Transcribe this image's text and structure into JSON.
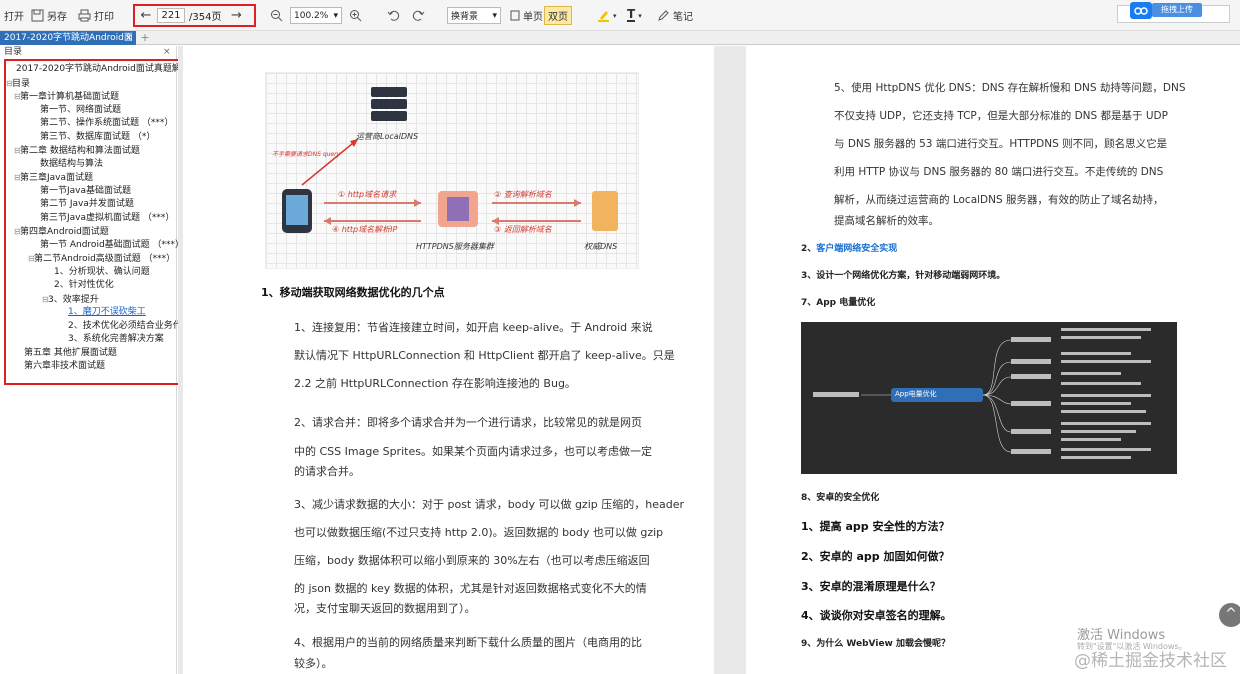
{
  "toolbar": {
    "open_label": "打开",
    "save_label": "另存",
    "print_label": "打印",
    "current_page": "221",
    "total_pages": "/354页",
    "zoom": "100.2%",
    "background_label": "换背景",
    "single_page_label": "单页",
    "double_page_label": "双页",
    "notes_label": "笔记",
    "upload_label": "拖拽上传"
  },
  "tabs": {
    "doc_tab_title": "2017-2020字节跳动Android面",
    "close_glyph": "×",
    "add_glyph": "+"
  },
  "sidebar": {
    "header": "目录",
    "close_glyph": "×",
    "toc": [
      "2017-2020字节跳动Android面试真题解析",
      "目录",
      "第一章计算机基础面试题",
      "第一节、网络面试题",
      "第二节、操作系统面试题 （***）",
      "第三节、数据库面试题 （*）",
      "第二章 数据结构和算法面试题",
      "数据结构与算法",
      "第三章Java面试题",
      "第一节Java基础面试题",
      "第二节 Java并发面试题",
      "第三节Java虚拟机面试题 （***）",
      "第四章Android面试题",
      "第一节 Android基础面试题 （***）",
      "第二节Android高级面试题 （***）",
      "1、分析现状、确认问题",
      "2、针对性优化",
      "3、效率提升",
      "1、磨刀不误砍柴工",
      "2、技术优化必须结合业务代码",
      "3、系统化完善解决方案",
      "第五章 其他扩展面试题",
      "第六章非技术面试题"
    ]
  },
  "page_left": {
    "figure_labels": {
      "operator_dns": "运营商LocalDNS",
      "red_note": "不手需要请求DNS query",
      "http_request": "① http域名请求",
      "query_domain": "② 查询解析域名",
      "return_ip": "④ http域名解析IP",
      "return_domain": "③ 返回解析域名",
      "httpdns_cluster": "HTTPDNS服务器集群",
      "authority_dns": "权威DNS"
    },
    "heading": "1、移动端获取网络数据优化的几个点",
    "paragraphs": [
      "1、连接复用：节省连接建立时间，如开启 keep-alive。于 Android 来说",
      "默认情况下 HttpURLConnection 和 HttpClient 都开启了 keep-alive。只是",
      "2.2 之前 HttpURLConnection 存在影响连接池的 Bug。",
      "2、请求合并：即将多个请求合并为一个进行请求，比较常见的就是网页",
      "中的 CSS Image Sprites。如果某个页面内请求过多，也可以考虑做一定",
      "的请求合并。",
      "3、减少请求数据的大小：对于 post 请求，body 可以做 gzip 压缩的，header",
      "也可以做数据压缩(不过只支持 http 2.0)。返回数据的 body 也可以做 gzip",
      "压缩，body 数据体积可以缩小到原来的 30%左右（也可以考虑压缩返回",
      "的 json 数据的 key 数据的体积，尤其是针对返回数据格式变化不大的情",
      "况，支付宝聊天返回的数据用到了）。",
      "4、根据用户的当前的网络质量来判断下载什么质量的图片（电商用的比",
      "较多）。"
    ]
  },
  "page_right": {
    "paragraphs": [
      "5、使用 HttpDNS 优化 DNS：DNS 存在解析慢和 DNS 劫持等问题，DNS",
      "不仅支持 UDP，它还支持 TCP，但是大部分标准的 DNS 都是基于 UDP",
      "与 DNS 服务器的 53 端口进行交互。HTTPDNS 则不同，顾名思义它是",
      "利用 HTTP 协议与 DNS 服务器的 80 端口进行交互。不走传统的 DNS",
      "解析，从而绕过运营商的 LocalDNS 服务器，有效的防止了域名劫持，",
      "提高域名解析的效率。"
    ],
    "item2_prefix": "2、",
    "item2_link": "客户端网络安全实现",
    "item3": "3、设计一个网络优化方案，针对移动端弱网环境。",
    "item7": "7、App 电量优化",
    "mindmap_center": "App电量优化",
    "item8": "8、安卓的安全优化",
    "questions": [
      "1、提高 app 安全性的方法？",
      "2、安卓的 app 加固如何做？",
      "3、安卓的混淆原理是什么？",
      "4、谈谈你对安卓签名的理解。"
    ],
    "item9": "9、为什么 WebView 加载会慢呢？"
  },
  "overlay": {
    "activate_windows": "激活 Windows",
    "activate_hint": "转到\"设置\"以激活 Windows。",
    "watermark": "@稀土掘金技术社区",
    "scroll_up_glyph": "^"
  }
}
